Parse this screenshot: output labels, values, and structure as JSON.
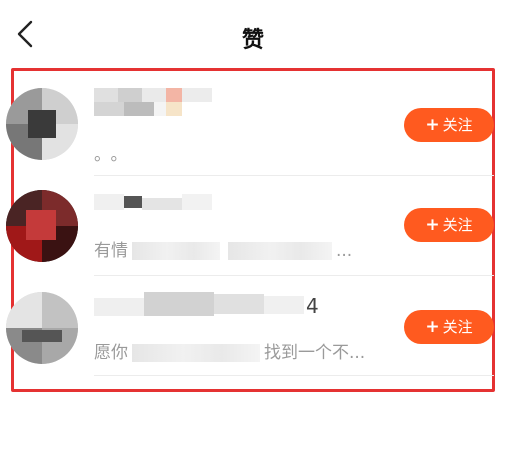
{
  "header": {
    "title": "赞",
    "back_icon": "chevron-left-icon"
  },
  "colors": {
    "accent": "#ff5a1f",
    "highlight_border": "#e53232"
  },
  "list": [
    {
      "name_suffix": "",
      "desc_visible": "。。",
      "desc_tail": "",
      "follow_label": "关注",
      "follow_icon": "plus-icon"
    },
    {
      "name_suffix": "",
      "desc_visible": "有情",
      "desc_tail": "...",
      "follow_label": "关注",
      "follow_icon": "plus-icon"
    },
    {
      "name_suffix": "4",
      "desc_visible": "愿你",
      "desc_tail": "找到一个不...",
      "follow_label": "关注",
      "follow_icon": "plus-icon"
    }
  ]
}
